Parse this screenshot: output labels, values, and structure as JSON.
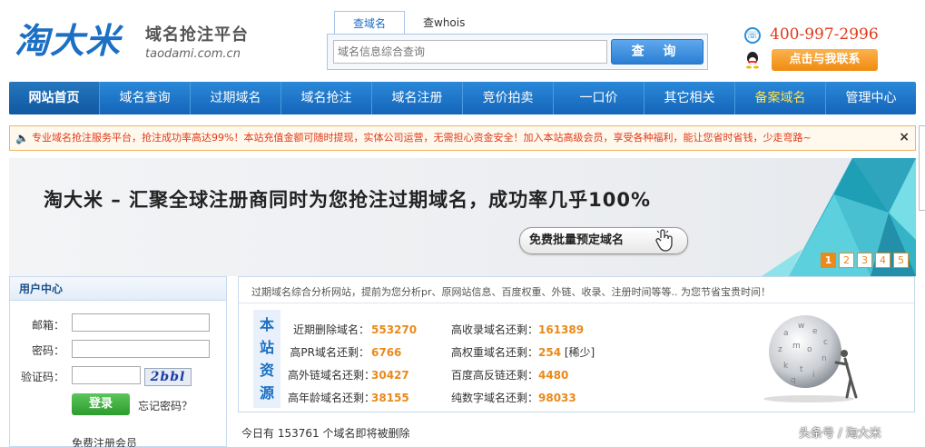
{
  "header": {
    "logo_text": "淘大米",
    "tagline": "域名抢注平台",
    "domain": "taodami.com.cn",
    "phone": "400-997-2996",
    "contact_label": "点击与我联系"
  },
  "search": {
    "tabs": [
      "查域名",
      "查whois"
    ],
    "placeholder": "域名信息综合查询",
    "button_label": "查 询"
  },
  "nav": {
    "items": [
      "网站首页",
      "域名查询",
      "过期域名",
      "域名抢注",
      "域名注册",
      "竞价拍卖",
      "一口价",
      "其它相关",
      "备案域名",
      "管理中心"
    ]
  },
  "notice": {
    "text": "专业域名抢注服务平台，抢注成功率高达99%！本站充值金额可随时提现，实体公司运营，无需担心资金安全！加入本站高级会员，享受各种福利，能让您省时省钱，少走弯路~",
    "close": "×"
  },
  "banner": {
    "title": "淘大米 – 汇聚全球注册商同时为您抢注过期域名，成功率几乎100%",
    "button_label": "免费批量预定域名",
    "pages": [
      "1",
      "2",
      "3",
      "4",
      "5"
    ]
  },
  "user_center": {
    "title": "用户中心",
    "email_label": "邮箱：",
    "password_label": "密码：",
    "captcha_label": "验证码：",
    "captcha_text": "2bbl",
    "login_label": "登录",
    "forgot_label": "忘记密码？",
    "register_label": "免费注册会员"
  },
  "stats": {
    "intro": "过期域名综合分析网站，提前为您分析pr、原网站信息、百度权重、外链、收录、注册时间等等.. 为您节省宝贵时间！",
    "side_title": [
      "本",
      "站",
      "资",
      "源"
    ],
    "left": [
      {
        "label": "近期删除域名：",
        "value": "553270"
      },
      {
        "label": "高PR域名还剩：",
        "value": "6766"
      },
      {
        "label": "高外链域名还剩：",
        "value": "30427"
      },
      {
        "label": "高年龄域名还剩：",
        "value": "38155"
      }
    ],
    "right": [
      {
        "label": "高收录域名还剩：",
        "value": "161389",
        "note": ""
      },
      {
        "label": "高权重域名还剩：",
        "value": "254",
        "note": " [稀少]"
      },
      {
        "label": "百度高反链还剩：",
        "value": "4480",
        "note": ""
      },
      {
        "label": "纯数字域名还剩：",
        "value": "98033",
        "note": ""
      }
    ],
    "today": "今日有 153761 个域名即将被删除"
  },
  "watermark": "头条号 / 淘大米"
}
